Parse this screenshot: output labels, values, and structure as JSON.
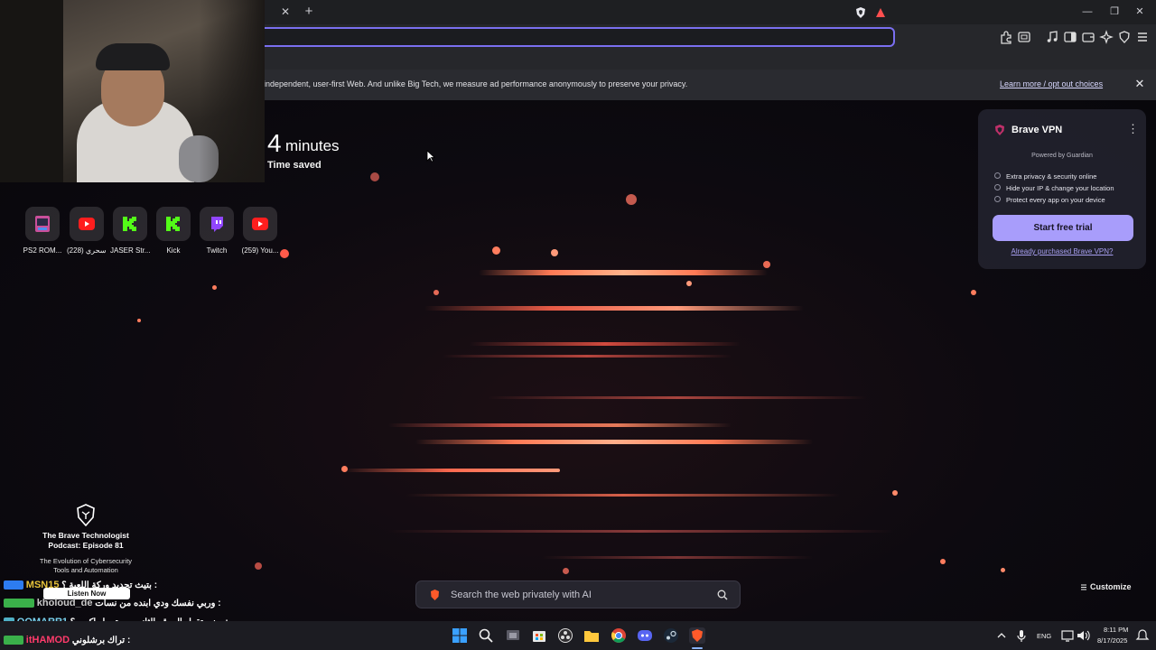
{
  "banner": {
    "text": "independent, user-first Web. And unlike Big Tech, we measure ad performance anonymously to preserve your privacy.",
    "link": "Learn more / opt out choices",
    "close": "✕"
  },
  "tabbar": {
    "close": "✕",
    "new_tab": "+",
    "minimize": "—",
    "restore": "❐",
    "close_window": "✕"
  },
  "stats": {
    "value": "4",
    "unit": "minutes",
    "label": "Time saved"
  },
  "top_sites": [
    {
      "label": "PS2 ROM...",
      "icon": "ps2-icon"
    },
    {
      "label": "(228) سحري...",
      "icon": "youtube-icon"
    },
    {
      "label": "JASER Str...",
      "icon": "kick-icon"
    },
    {
      "label": "Kick",
      "icon": "kick-icon"
    },
    {
      "label": "Twitch",
      "icon": "twitch-icon"
    },
    {
      "label": "(259) You...",
      "icon": "youtube-icon"
    }
  ],
  "vpn": {
    "title": "Brave VPN",
    "more": "⋮",
    "powered": "Powered by  Guardian",
    "features": [
      "Extra privacy & security online",
      "Hide your IP & change your location",
      "Protect every app on your device"
    ],
    "cta": "Start free trial",
    "link": "Already purchased Brave VPN?"
  },
  "search": {
    "placeholder": "Search the web privately with AI"
  },
  "customize": "Customize",
  "podcast": {
    "title_line1": "The Brave Technologist",
    "title_line2": "Podcast: Episode 81",
    "sub_line1": "The Evolution of Cybersecurity",
    "sub_line2": "Tools and Automation",
    "listen": "Listen Now"
  },
  "chat": [
    {
      "name": "MSN15",
      "msg": "بتيث تحديد وركة اللعبة ؟ :",
      "color": "#e6c23a"
    },
    {
      "name": "kholoud_de",
      "msg": "وربي نفسك ودي ابنده من نسات :",
      "color": "#c9c9c9"
    },
    {
      "name": "OOMARR1",
      "msg": "يعني تقول الموقع الثاني من تريبل اكس ؟ :",
      "color": "#7ad3f0"
    },
    {
      "name": "itHAMOD",
      "msg": "تراك برشلوني :",
      "color": "#ff3b6b"
    }
  ],
  "tray": {
    "lang": "ENG",
    "time": "8:11 PM",
    "date": "8/17/2025"
  },
  "colors": {
    "accent": "#a89dfb",
    "url_border": "#7a6ff0",
    "streak": "#ff6a4a"
  }
}
